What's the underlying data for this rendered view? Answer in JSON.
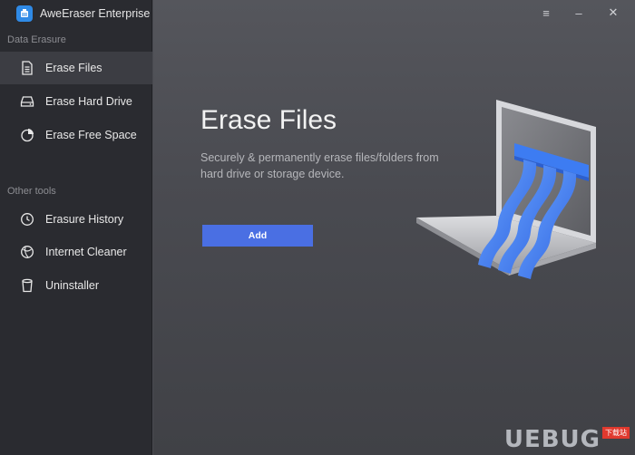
{
  "app": {
    "title": "AweEraser Enterprise"
  },
  "sidebar": {
    "section1": "Data Erasure",
    "section2": "Other tools",
    "items": [
      {
        "label": "Erase Files",
        "icon": "file-icon",
        "active": true
      },
      {
        "label": "Erase Hard Drive",
        "icon": "hard-drive-icon"
      },
      {
        "label": "Erase Free Space",
        "icon": "pie-chart-icon"
      },
      {
        "label": "Erasure History",
        "icon": "clock-icon"
      },
      {
        "label": "Internet Cleaner",
        "icon": "browser-icon"
      },
      {
        "label": "Uninstaller",
        "icon": "trash-icon"
      }
    ]
  },
  "window_controls": {
    "menu": "≡",
    "minimize": "–",
    "close": "✕"
  },
  "main": {
    "title": "Erase Files",
    "description": "Securely & permanently erase files/folders from hard drive or storage device.",
    "add_button": "Add"
  },
  "watermark": {
    "text": "UEBUG",
    "badge": "下载站"
  },
  "colors": {
    "sidebar": "#2a2b30",
    "main": "#4a4b51",
    "accent": "#4a6fe3",
    "illustration": "#3f7df0"
  }
}
